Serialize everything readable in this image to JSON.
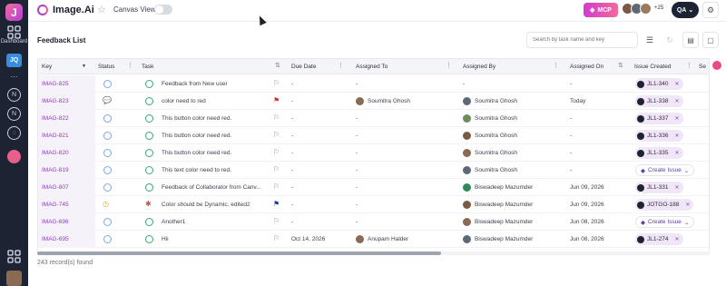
{
  "sidebar": {
    "logo_letter": "J",
    "dashboard_label": "Dashboard",
    "project_badge": "JQ",
    "n_icon_letter": "N"
  },
  "header": {
    "title": "Image.Ai",
    "canvas_view_label": "Canvas View",
    "mcp_label": "MCP",
    "members_more": "+25",
    "user_initials": "QA"
  },
  "page": {
    "title": "Feedback List",
    "search_placeholder": "Search by task name and key",
    "footer": "243 record(s) found"
  },
  "columns": [
    "Key",
    "Status",
    "Task",
    "Due Date",
    "Assigned To",
    "Assigned By",
    "Assigned On",
    "Issue Created",
    "Se"
  ],
  "create_issue_label": "Create Issue",
  "rows": [
    {
      "key": "IMAG-825",
      "status": "open",
      "task": "Feedback from New user",
      "due": "-",
      "assigned_to": "-",
      "assigned_by": "-",
      "assigned_on": "-",
      "issue": "JL1-340",
      "flag": "empty"
    },
    {
      "key": "IMAG-823",
      "status": "comment",
      "task": "color need to red",
      "due": "-",
      "assigned_to": "Soumitra Ghosh",
      "assigned_by": "Soumitra Ghosh",
      "assigned_on": "Today",
      "issue": "JL1-338",
      "flag": "red"
    },
    {
      "key": "IMAG-822",
      "status": "open",
      "task": "This button color need red.",
      "due": "-",
      "assigned_to": "-",
      "assigned_by": "Soumitra Ghosh",
      "assigned_on": "-",
      "issue": "JL1-337",
      "flag": "empty"
    },
    {
      "key": "IMAG-821",
      "status": "open",
      "task": "This button color need red.",
      "due": "-",
      "assigned_to": "-",
      "assigned_by": "Soumitra Ghosh",
      "assigned_on": "-",
      "issue": "JL1-336",
      "flag": "empty"
    },
    {
      "key": "IMAG-820",
      "status": "open",
      "task": "This button color need red.",
      "due": "-",
      "assigned_to": "-",
      "assigned_by": "Soumitra Ghosh",
      "assigned_on": "-",
      "issue": "JL1-335",
      "flag": "empty"
    },
    {
      "key": "IMAG-819",
      "status": "open",
      "task": "This text color need to red.",
      "due": "-",
      "assigned_to": "-",
      "assigned_by": "Soumitra Ghosh",
      "assigned_on": "-",
      "issue": "",
      "flag": "empty"
    },
    {
      "key": "IMAG-807",
      "status": "open",
      "task": "Feedback of Collaborator from Canv...",
      "due": "-",
      "assigned_to": "-",
      "assigned_by": "Biswadeep Mazumder",
      "assigned_on": "Jun 09, 2026",
      "issue": "JL1-331",
      "flag": "empty"
    },
    {
      "key": "IMAG-745",
      "status": "clock",
      "task": "Color should be Dynamic. edited2",
      "due": "-",
      "assigned_to": "-",
      "assigned_by": "Biswadeep Mazumder",
      "assigned_on": "Jun 09, 2026",
      "issue": "JOTGO-188",
      "flag": "blue"
    },
    {
      "key": "IMAG-696",
      "status": "open",
      "task": "Another1",
      "due": "-",
      "assigned_to": "-",
      "assigned_by": "Biswadeep Mazumder",
      "assigned_on": "Jun 08, 2026",
      "issue": "",
      "flag": "empty"
    },
    {
      "key": "IMAG-695",
      "status": "open",
      "task": "Hii",
      "due": "Oct 14, 2026",
      "assigned_to": "Anupam Halder",
      "assigned_by": "Biswadeep Mazumder",
      "assigned_on": "Jun 08, 2026",
      "issue": "JL1-274",
      "flag": "empty"
    }
  ]
}
